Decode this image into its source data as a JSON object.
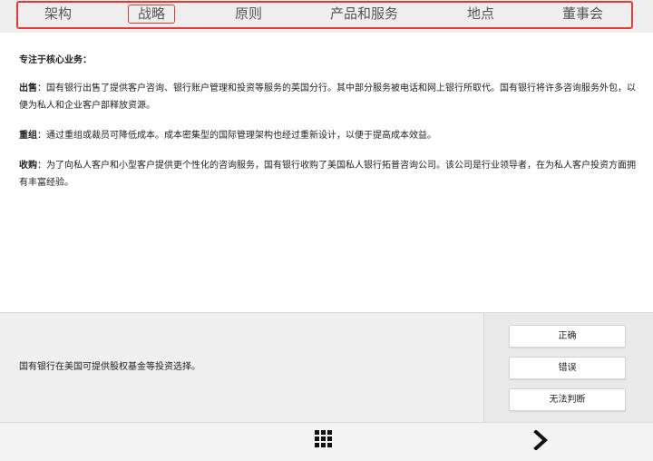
{
  "nav": {
    "tabs": [
      {
        "label": "架构"
      },
      {
        "label": "战略"
      },
      {
        "label": "原则"
      },
      {
        "label": "产品和服务"
      },
      {
        "label": "地点"
      },
      {
        "label": "董事会"
      }
    ],
    "active_tab": "战略",
    "highlight_color": "#e53935"
  },
  "content": {
    "heading": "专注于核心业务：",
    "paragraphs": [
      {
        "term": "出售",
        "separator": "：",
        "text": "国有银行出售了提供客户咨询、银行账户管理和投资等服务的英国分行。其中部分服务被电话和网上银行所取代。国有银行将许多咨询服务外包，以便为私人和企业客户部释放资源。"
      },
      {
        "term": "重组",
        "separator": "：",
        "text": "通过重组或裁员可降低成本。成本密集型的国际管理架构也经过重新设计，以便于提高成本效益。"
      },
      {
        "term": "收购",
        "separator": "：",
        "text": "为了向私人客户和小型客户提供更个性化的咨询服务，国有银行收购了美国私人银行拓普咨询公司。该公司是行业领导者，在为私人客户投资方面拥有丰富经验。"
      }
    ]
  },
  "question": {
    "statement": "国有银行在美国可提供股权基金等投资选择。",
    "answers": [
      {
        "label": "正确"
      },
      {
        "label": "错误"
      },
      {
        "label": "无法判断"
      }
    ]
  },
  "footer": {
    "menu_icon": "grid-menu-icon",
    "next_icon": "chevron-right-icon"
  }
}
